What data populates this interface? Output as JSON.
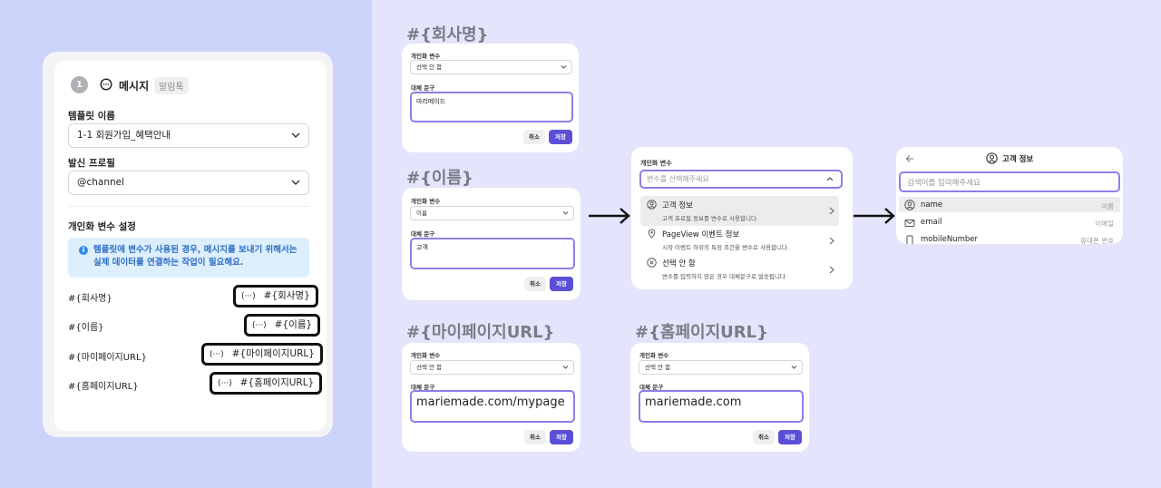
{
  "main_panel": {
    "step_number": "1",
    "section_title": "메시지",
    "channel_badge": "알림톡",
    "template_label": "템플릿 이름",
    "template_value": "1-1 회원가입_혜택안내",
    "profile_label": "발신 프로필",
    "profile_value": "@channel",
    "variables_heading": "개인화 변수 설정",
    "info_text": "템플릿에 변수가 사용된 경우, 메시지를 보내기 위해서는 실제 데이터를 연결하는 작업이 필요해요.",
    "variables": [
      {
        "label": "#{회사명}",
        "chip": "#{회사명}"
      },
      {
        "label": "#{이름}",
        "chip": "#{이름}"
      },
      {
        "label": "#{마이페이지URL}",
        "chip": "#{마이페이지URL}"
      },
      {
        "label": "#{홈페이지URL}",
        "chip": "#{홈페이지URL}"
      }
    ],
    "chip_dots": "(···)"
  },
  "cards": {
    "company": {
      "title": "#{회사명}",
      "var_label": "개인화 변수",
      "select_value": "선택 안 함",
      "alt_label": "대체 문구",
      "input_value": "마리메이드",
      "cancel": "취소",
      "save": "저장"
    },
    "name": {
      "title": "#{이름}",
      "var_label": "개인화 변수",
      "select_value": "이름",
      "alt_label": "대체 문구",
      "input_value": "고객",
      "cancel": "취소",
      "save": "저장"
    },
    "mypage": {
      "title": "#{마이페이지URL}",
      "var_label": "개인화 변수",
      "select_value": "선택 안 함",
      "alt_label": "대체 문구",
      "input_value": "mariemade.com/mypage",
      "cancel": "취소",
      "save": "저장"
    },
    "homepage": {
      "title": "#{홈페이지URL}",
      "var_label": "개인화 변수",
      "select_value": "선택 안 함",
      "alt_label": "대체 문구",
      "input_value": "mariemade.com",
      "cancel": "취소",
      "save": "저장"
    }
  },
  "dropdown": {
    "label": "개인화 변수",
    "placeholder": "변수를 선택해주세요",
    "items": [
      {
        "title": "고객 정보",
        "sub": "고객 프로필 정보를 변수로 사용합니다."
      },
      {
        "title": "PageView 이벤트 정보",
        "sub": "시작 이벤트 하위의 특정 조건을 변수로 사용합니다."
      },
      {
        "title": "선택 안 함",
        "sub": "변수를 입력하지 않은 경우 대체문구로 발송됩니다."
      }
    ]
  },
  "customer_info": {
    "title": "고객 정보",
    "search_placeholder": "검색어를 입력해주세요",
    "rows": [
      {
        "name": "name",
        "desc": "이름",
        "icon": "person-icon"
      },
      {
        "name": "email",
        "desc": "이메일",
        "icon": "mail-icon"
      },
      {
        "name": "mobileNumber",
        "desc": "휴대폰 번호",
        "icon": "phone-icon"
      }
    ]
  },
  "colors": {
    "accent": "#5b4fd8",
    "input_border": "#8b80e8",
    "info_bg": "#ddeefd",
    "info_text": "#2d6fc4"
  }
}
